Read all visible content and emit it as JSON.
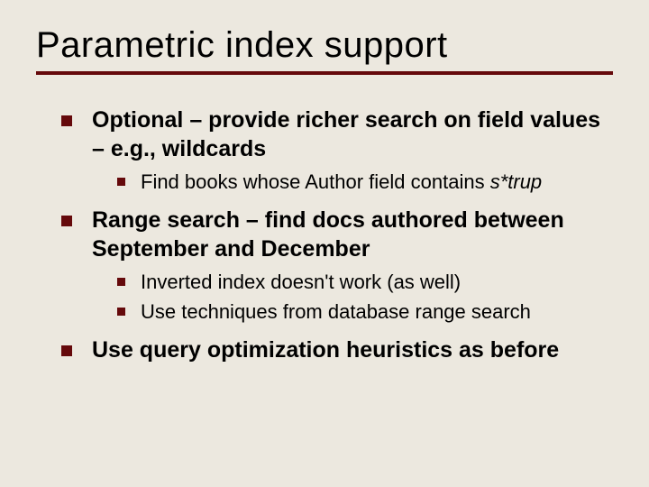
{
  "title": "Parametric index support",
  "bullets": [
    {
      "text_a": "Optional – provide richer search on field values – e.g., wildcards",
      "sub": [
        {
          "text_a": "Find books whose Author field contains ",
          "italic_tail": "s*trup"
        }
      ]
    },
    {
      "text_a": "Range search – find docs authored between September and December",
      "sub": [
        {
          "text_a": "Inverted index doesn't work (as well)"
        },
        {
          "text_a": "Use techniques from database range search"
        }
      ]
    },
    {
      "text_a": "Use query optimization heuristics as before",
      "sub": []
    }
  ]
}
